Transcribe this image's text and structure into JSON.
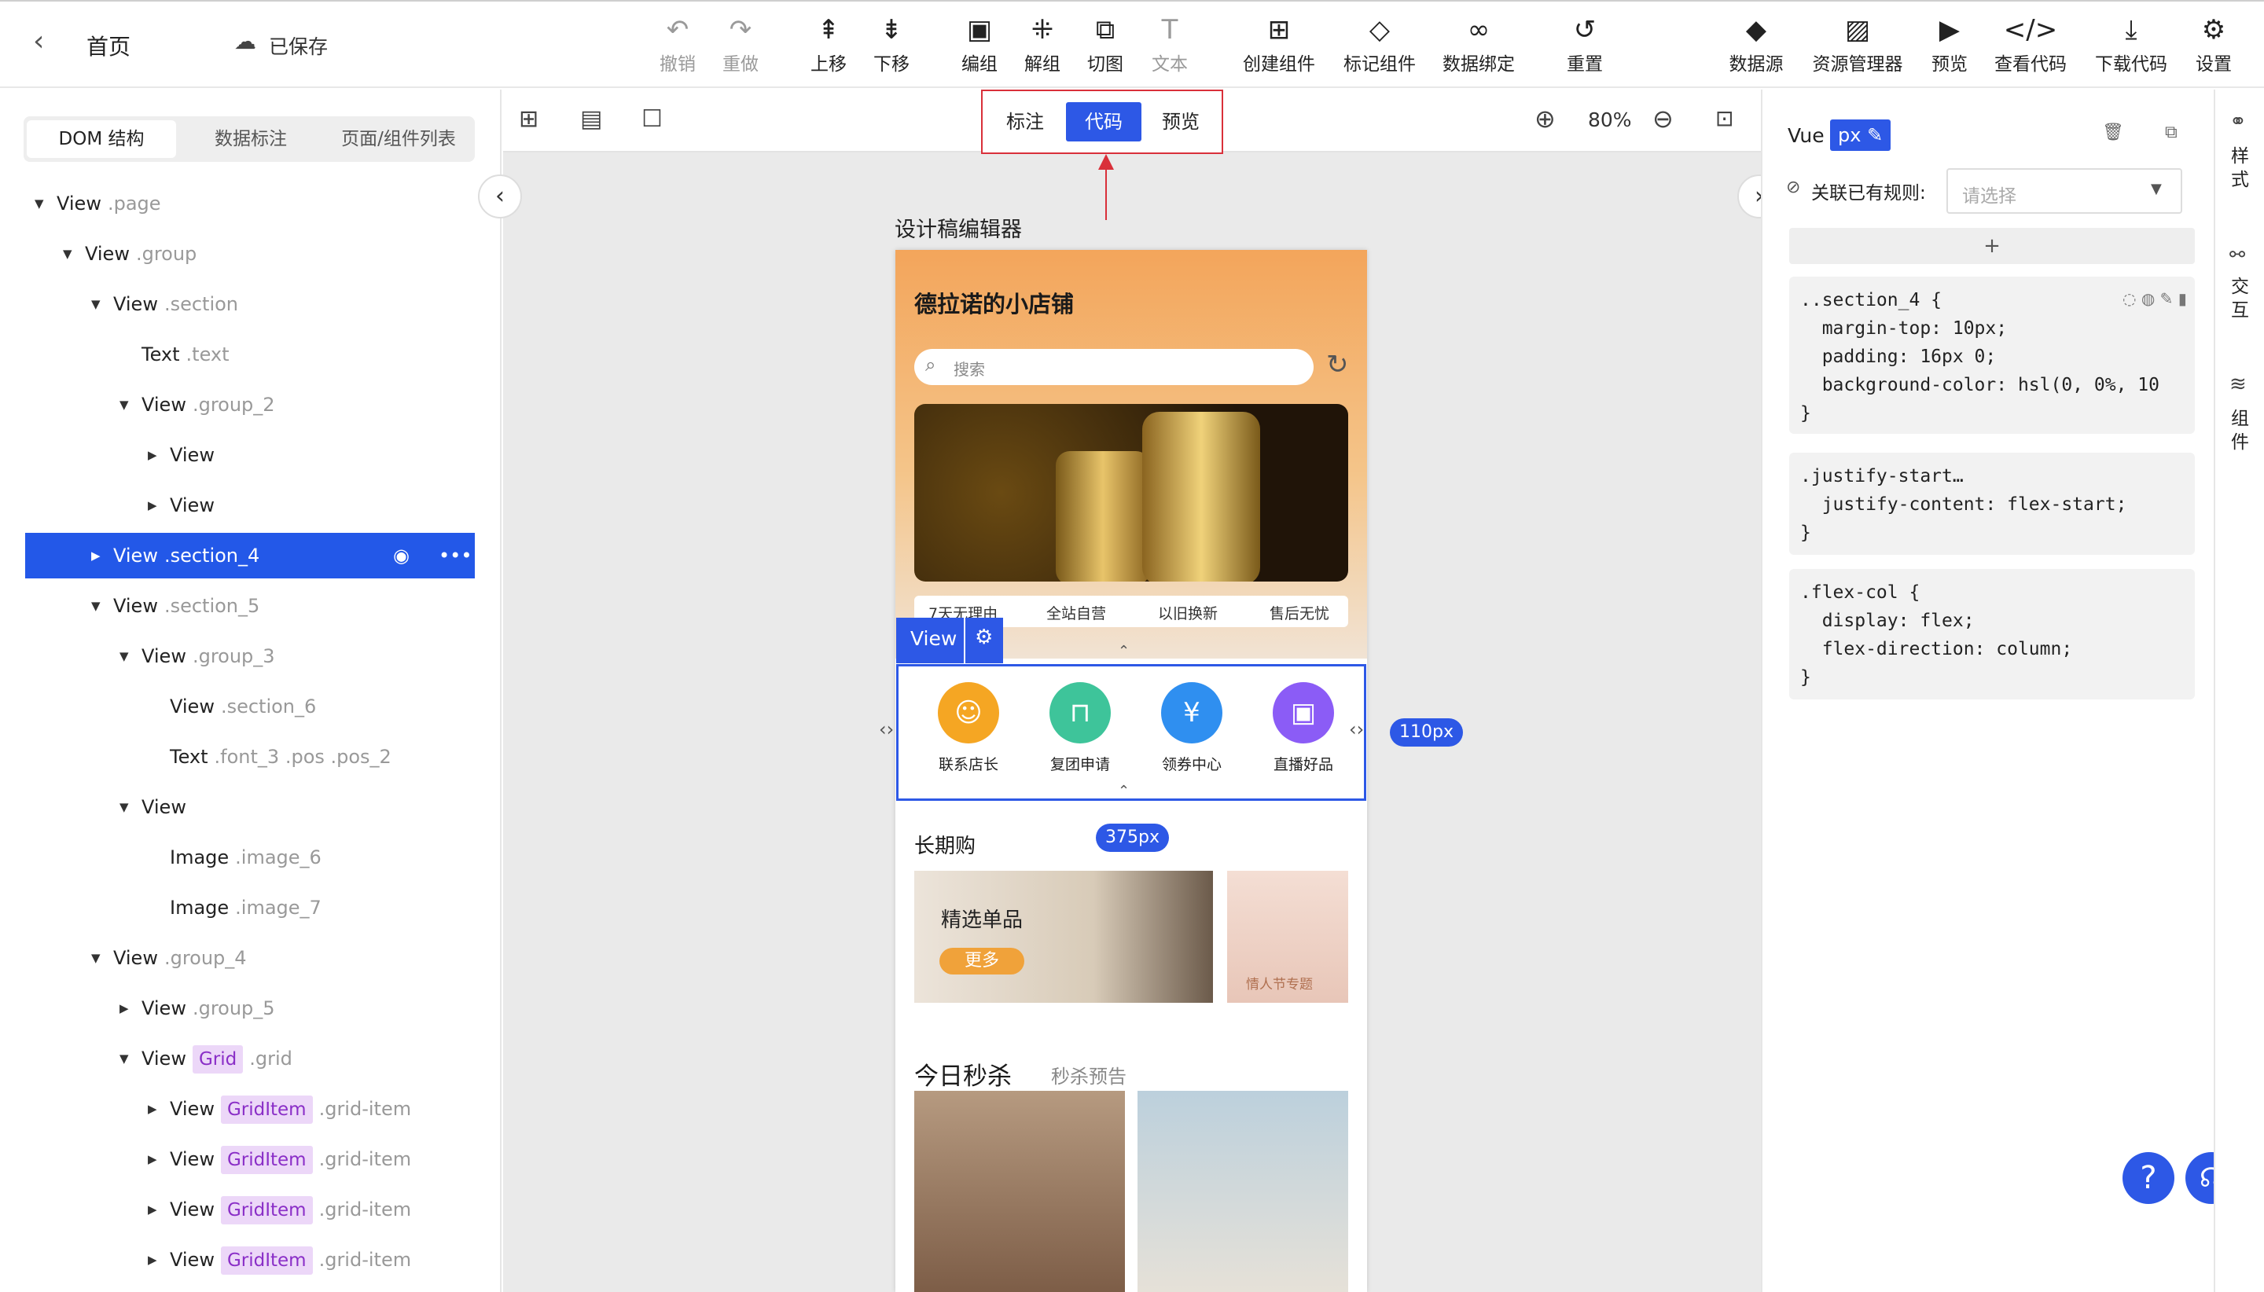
{
  "topbar": {
    "back_icon": "chevron-left-icon",
    "home": "首页",
    "saved": "已保存",
    "tools": [
      {
        "label": "撤销",
        "icon": "undo-icon",
        "disabled": true
      },
      {
        "label": "重做",
        "icon": "redo-icon",
        "disabled": true
      },
      {
        "label": "上移",
        "icon": "move-up-icon",
        "disabled": false
      },
      {
        "label": "下移",
        "icon": "move-down-icon",
        "disabled": false
      },
      {
        "label": "编组",
        "icon": "group-icon",
        "disabled": false
      },
      {
        "label": "解组",
        "icon": "ungroup-icon",
        "disabled": false
      },
      {
        "label": "切图",
        "icon": "slice-icon",
        "disabled": false
      },
      {
        "label": "文本",
        "icon": "text-icon",
        "disabled": true
      },
      {
        "label": "创建组件",
        "icon": "plus-box-icon",
        "disabled": false
      },
      {
        "label": "标记组件",
        "icon": "tag-icon",
        "disabled": false
      },
      {
        "label": "数据绑定",
        "icon": "link-icon",
        "disabled": false
      },
      {
        "label": "重置",
        "icon": "reset-icon",
        "disabled": false
      },
      {
        "label": "数据源",
        "icon": "cube-icon",
        "disabled": false
      },
      {
        "label": "资源管理器",
        "icon": "image-icon",
        "disabled": false
      },
      {
        "label": "预览",
        "icon": "play-icon",
        "disabled": false
      },
      {
        "label": "查看代码",
        "icon": "code-icon",
        "disabled": false
      },
      {
        "label": "下载代码",
        "icon": "download-icon",
        "disabled": false
      },
      {
        "label": "设置",
        "icon": "gear-icon",
        "disabled": false
      }
    ]
  },
  "left": {
    "tabs": [
      "DOM 结构",
      "数据标注",
      "页面/组件列表"
    ],
    "tree": [
      {
        "tag": "View",
        "cls": ".page",
        "depth": 0,
        "caret": "down"
      },
      {
        "tag": "View",
        "cls": ".group",
        "depth": 1,
        "caret": "down"
      },
      {
        "tag": "View",
        "cls": ".section",
        "depth": 2,
        "caret": "down"
      },
      {
        "tag": "Text",
        "cls": ".text",
        "depth": 3,
        "caret": ""
      },
      {
        "tag": "View",
        "cls": ".group_2",
        "depth": 3,
        "caret": "down"
      },
      {
        "tag": "View",
        "cls": "",
        "depth": 4,
        "caret": "right"
      },
      {
        "tag": "View",
        "cls": "",
        "depth": 4,
        "caret": "right"
      },
      {
        "tag": "View",
        "cls": ".section_4",
        "depth": 2,
        "caret": "right",
        "selected": true
      },
      {
        "tag": "View",
        "cls": ".section_5",
        "depth": 2,
        "caret": "down"
      },
      {
        "tag": "View",
        "cls": ".group_3",
        "depth": 3,
        "caret": "down"
      },
      {
        "tag": "View",
        "cls": ".section_6",
        "depth": 4,
        "caret": ""
      },
      {
        "tag": "Text",
        "cls": ".font_3 .pos .pos_2",
        "depth": 4,
        "caret": ""
      },
      {
        "tag": "View",
        "cls": "",
        "depth": 3,
        "caret": "down"
      },
      {
        "tag": "Image",
        "cls": ".image_6",
        "depth": 4,
        "caret": ""
      },
      {
        "tag": "Image",
        "cls": ".image_7",
        "depth": 4,
        "caret": ""
      },
      {
        "tag": "View",
        "cls": ".group_4",
        "depth": 2,
        "caret": "down"
      },
      {
        "tag": "View",
        "cls": ".group_5",
        "depth": 3,
        "caret": "right"
      },
      {
        "tag": "View",
        "badge": "Grid",
        "cls": ".grid",
        "depth": 3,
        "caret": "down"
      },
      {
        "tag": "View",
        "badge": "GridItem",
        "cls": ".grid-item",
        "depth": 4,
        "caret": "right"
      },
      {
        "tag": "View",
        "badge": "GridItem",
        "cls": ".grid-item",
        "depth": 4,
        "caret": "right"
      },
      {
        "tag": "View",
        "badge": "GridItem",
        "cls": ".grid-item",
        "depth": 4,
        "caret": "right"
      },
      {
        "tag": "View",
        "badge": "GridItem",
        "cls": ".grid-item",
        "depth": 4,
        "caret": "right"
      }
    ]
  },
  "canvas": {
    "segments": [
      "标注",
      "代码",
      "预览"
    ],
    "active_segment": "代码",
    "zoom": "80%",
    "title": "设计稿编辑器",
    "sel_tag": "View",
    "height_pill": "110px",
    "width_pill": "375px"
  },
  "phone": {
    "shop": "德拉诺的小店铺",
    "search_placeholder": "搜索",
    "perks": [
      "7天无理由",
      "全站自营",
      "以旧换新",
      "售后无忧"
    ],
    "services": [
      {
        "label": "联系店长",
        "color": "#f5a623",
        "glyph": "☺"
      },
      {
        "label": "复团申请",
        "color": "#3ec49a",
        "glyph": "⊓"
      },
      {
        "label": "领券中心",
        "color": "#2f8ff0",
        "glyph": "¥"
      },
      {
        "label": "直播好品",
        "color": "#8b5cf6",
        "glyph": "▣"
      }
    ],
    "long_title": "长期购",
    "featured": "精选单品",
    "more": "更多",
    "valentine": "情人节专题",
    "flash_title": "今日秒杀",
    "flash_sub": "秒杀预告"
  },
  "right": {
    "framework": "Vue",
    "unit": "px",
    "rule_label": "关联已有规则:",
    "rule_placeholder": "请选择",
    "add": "+",
    "blocks": [
      "..section_4 {\n  margin-top: 10px;\n  padding: 16px 0;\n  background-color: hsl(0, 0%, 10\n}",
      ".justify-start…\n  justify-content: flex-start;\n}",
      ".flex-col {\n  display: flex;\n  flex-direction: column;\n}"
    ]
  },
  "rightbar": [
    "样式",
    "交互",
    "组件"
  ]
}
